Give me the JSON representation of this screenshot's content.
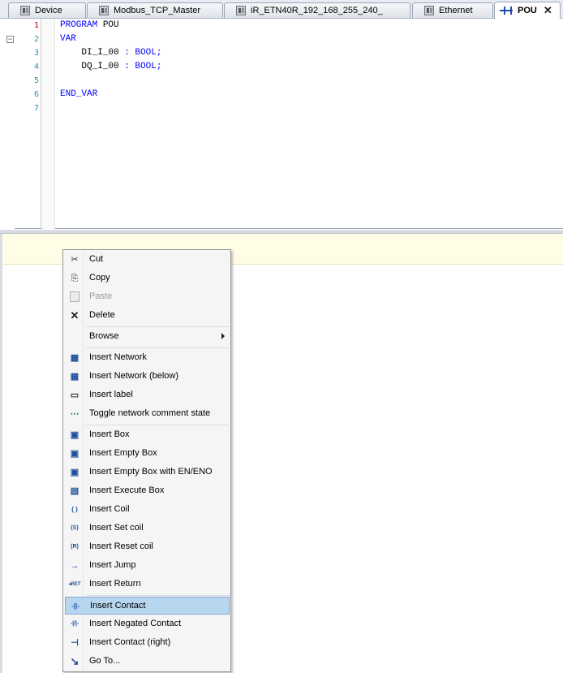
{
  "tabs": [
    {
      "label": "Device",
      "icon": "device-icon"
    },
    {
      "label": "Modbus_TCP_Master",
      "icon": "device-icon"
    },
    {
      "label": "iR_ETN40R_192_168_255_240_",
      "icon": "device-icon"
    },
    {
      "label": "Ethernet",
      "icon": "device-icon"
    },
    {
      "label": "POU",
      "icon": "ladder-pou-icon",
      "active": true,
      "close": "✕"
    }
  ],
  "editor": {
    "line_numbers": [
      "1",
      "2",
      "3",
      "4",
      "5",
      "6",
      "7"
    ],
    "fold_symbol": "−",
    "lines": [
      {
        "keyword": "PROGRAM",
        "rest": " POU"
      },
      {
        "keyword": "VAR",
        "rest": ""
      },
      {
        "keyword": "",
        "rest": "    DI_I_00 ",
        "type": ": BOOL;"
      },
      {
        "keyword": "",
        "rest": "    DQ_I_00 ",
        "type": ": BOOL;"
      },
      {
        "keyword": "",
        "rest": ""
      },
      {
        "keyword": "END_VAR",
        "rest": ""
      },
      {
        "keyword": "",
        "rest": ""
      }
    ]
  },
  "context_menu": {
    "items": [
      {
        "label": "Cut",
        "icon": "scissors-icon"
      },
      {
        "label": "Copy",
        "icon": "copy-icon"
      },
      {
        "label": "Paste",
        "icon": "paste-icon",
        "disabled": true
      },
      {
        "label": "Delete",
        "icon": "delete-x-icon"
      },
      {
        "label": "Browse",
        "icon": "",
        "submenu": true
      },
      {
        "label": "Insert Network",
        "icon": "insert-network-icon"
      },
      {
        "label": "Insert Network (below)",
        "icon": "insert-network-below-icon"
      },
      {
        "label": "Insert label",
        "icon": "label-icon"
      },
      {
        "label": "Toggle network comment state",
        "icon": "comment-toggle-icon"
      },
      {
        "label": "Insert Box",
        "icon": "box-icon"
      },
      {
        "label": "Insert Empty Box",
        "icon": "empty-box-icon"
      },
      {
        "label": "Insert Empty Box with EN/ENO",
        "icon": "empty-box-en-eno-icon"
      },
      {
        "label": "Insert Execute Box",
        "icon": "execute-box-icon"
      },
      {
        "label": "Insert Coil",
        "icon": "coil-icon"
      },
      {
        "label": "Insert Set coil",
        "icon": "set-coil-icon"
      },
      {
        "label": "Insert Reset coil",
        "icon": "reset-coil-icon"
      },
      {
        "label": "Insert Jump",
        "icon": "jump-arrow-icon"
      },
      {
        "label": "Insert Return",
        "icon": "return-icon"
      },
      {
        "label": "Insert Contact",
        "icon": "contact-icon",
        "highlighted": true
      },
      {
        "label": "Insert Negated Contact",
        "icon": "negated-contact-icon"
      },
      {
        "label": "Insert Contact (right)",
        "icon": "contact-right-icon"
      },
      {
        "label": "Go To...",
        "icon": "goto-icon"
      }
    ],
    "icon_glyphs": {
      "scissors-icon": "✂",
      "copy-icon": "⎘",
      "paste-icon": "📋",
      "delete-x-icon": "✕",
      "insert-network-icon": "▦",
      "insert-network-below-icon": "▦",
      "label-icon": "▭",
      "comment-toggle-icon": "⋯",
      "box-icon": "▣",
      "empty-box-icon": "▣",
      "empty-box-en-eno-icon": "▣",
      "execute-box-icon": "▤",
      "coil-icon": "( )",
      "set-coil-icon": "(S)",
      "reset-coil-icon": "(R)",
      "jump-arrow-icon": "→",
      "return-icon": "◂RET",
      "contact-icon": "-||-",
      "negated-contact-icon": "-|/|-",
      "contact-right-icon": "⊣",
      "goto-icon": "↘"
    }
  },
  "colors": {
    "keyword": "#0000ff",
    "line_number": "#2b91af",
    "current_line_number": "#c00000",
    "menu_highlight": "#b8d6f0",
    "network_strip": "#fffde6"
  }
}
